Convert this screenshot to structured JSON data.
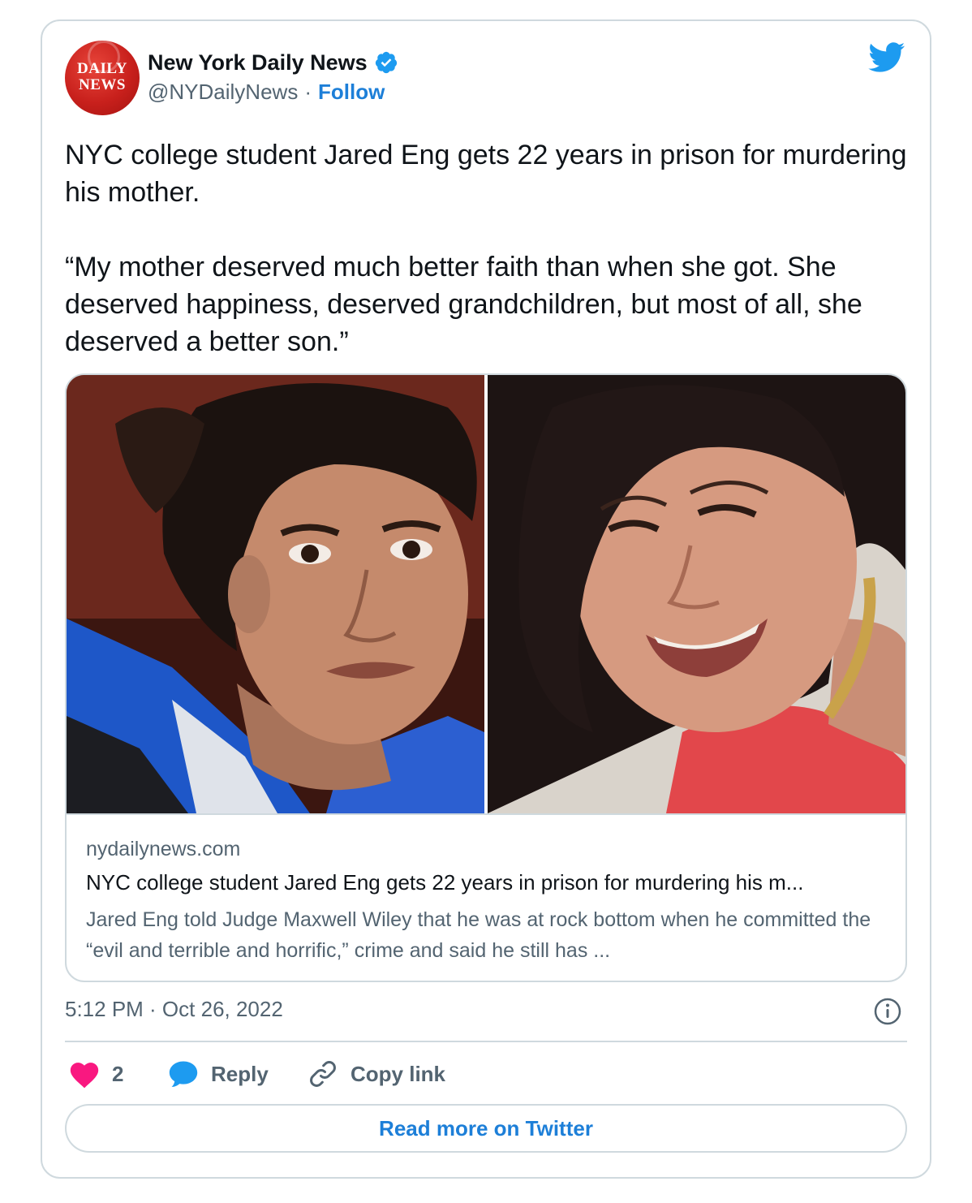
{
  "account": {
    "avatar_lines": [
      "DAILY",
      "NEWS"
    ],
    "name": "New York Daily News",
    "handle": "@NYDailyNews",
    "separator": "·",
    "follow_label": "Follow"
  },
  "tweet": {
    "paragraph1": "NYC college student Jared Eng gets 22 years in prison for murdering his mother.",
    "paragraph2": "“My mother deserved much better faith than when she got. She deserved happiness, deserved grandchildren, but most of all, she deserved a better son.”"
  },
  "link_card": {
    "domain": "nydailynews.com",
    "title": "NYC college student Jared Eng gets 22 years in prison for murdering his m...",
    "description": "Jared Eng told Judge Maxwell Wiley that he was at rock bottom when he committed the “evil and terrible and horrific,” crime and said he still has ..."
  },
  "meta": {
    "timestamp": "5:12 PM · Oct 26, 2022"
  },
  "actions": {
    "like_count": "2",
    "reply_label": "Reply",
    "copy_label": "Copy link"
  },
  "read_more_label": "Read more on Twitter",
  "colors": {
    "accent": "#1d7fd8",
    "like": "#f91880",
    "reply": "#1d9bf0",
    "muted_text": "#536471",
    "border": "#cfd9de",
    "brand_red": "#c8201c"
  },
  "icons": {
    "verified": "verified-badge-icon",
    "twitter": "twitter-bird-icon",
    "info": "info-icon",
    "like": "heart-icon",
    "reply": "speech-bubble-icon",
    "copy": "link-icon"
  }
}
